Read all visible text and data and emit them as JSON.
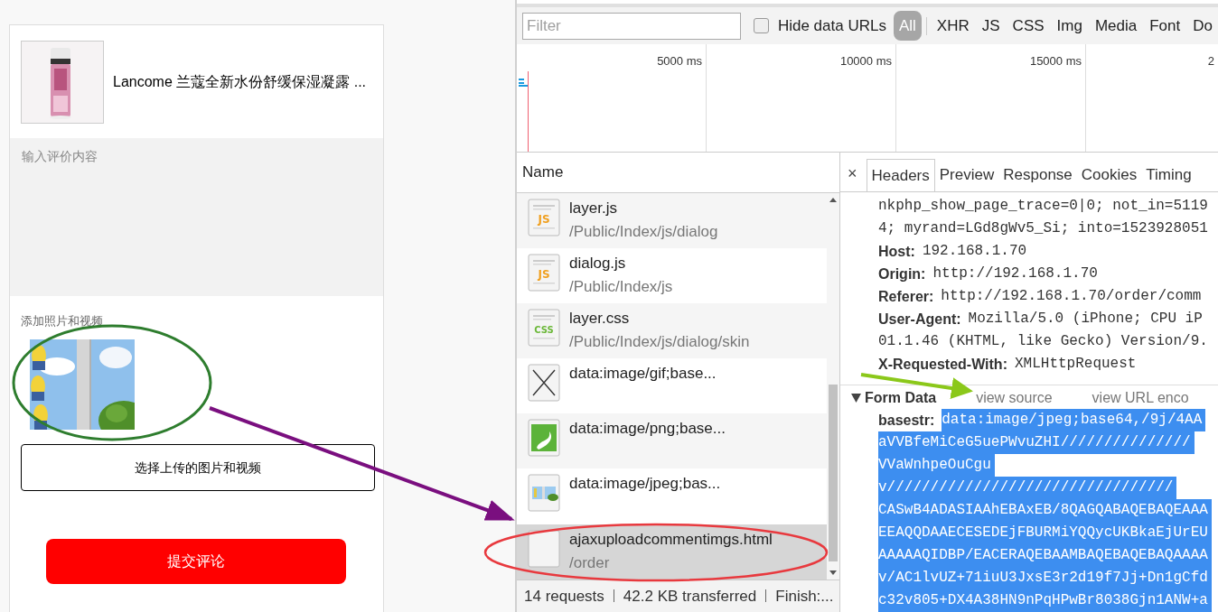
{
  "product": {
    "title": "Lancome 兰蔻全新水份舒缓保湿凝露 ..."
  },
  "review_field": {
    "placeholder": "输入评价内容"
  },
  "media": {
    "label": "添加照片和视频",
    "choose_button": "选择上传的图片和视频"
  },
  "submit_button": "提交评论",
  "devtools": {
    "filter": {
      "placeholder": "Filter"
    },
    "hide_data_urls": {
      "label": "Hide data URLs",
      "checked": false
    },
    "type_filters": [
      {
        "label": "All",
        "selected": true
      },
      {
        "label": "XHR",
        "selected": false
      },
      {
        "label": "JS",
        "selected": false
      },
      {
        "label": "CSS",
        "selected": false
      },
      {
        "label": "Img",
        "selected": false
      },
      {
        "label": "Media",
        "selected": false
      },
      {
        "label": "Font",
        "selected": false
      },
      {
        "label": "Do",
        "selected": false
      }
    ],
    "timeline_ticks": [
      "5000 ms",
      "10000 ms",
      "15000 ms",
      "2"
    ],
    "name_column": "Name",
    "requests": [
      {
        "kind": "js",
        "icon_label": "JS",
        "name": "layer.js",
        "path": "/Public/Index/js/dialog",
        "selected": false
      },
      {
        "kind": "js",
        "icon_label": "JS",
        "name": "dialog.js",
        "path": "/Public/Index/js",
        "selected": false
      },
      {
        "kind": "css",
        "icon_label": "CSS",
        "name": "layer.css",
        "path": "/Public/Index/js/dialog/skin",
        "selected": false
      },
      {
        "kind": "gif",
        "name": "data:image/gif;base...",
        "selected": false
      },
      {
        "kind": "png",
        "name": "data:image/png;base...",
        "selected": false
      },
      {
        "kind": "jpeg",
        "name": "data:image/jpeg;bas...",
        "selected": false
      },
      {
        "kind": "html",
        "name": "ajaxuploadcommentimgs.html",
        "path": "/order",
        "selected": true
      }
    ],
    "status": [
      "14 requests",
      "42.2 KB transferred",
      "Finish:..."
    ],
    "close": "×",
    "tabs": [
      {
        "label": "Headers",
        "selected": true
      },
      {
        "label": "Preview",
        "selected": false
      },
      {
        "label": "Response",
        "selected": false
      },
      {
        "label": "Cookies",
        "selected": false
      },
      {
        "label": "Timing",
        "selected": false
      }
    ],
    "header_lines": [
      {
        "value": "nkphp_show_page_trace=0|0; not_in=5119"
      },
      {
        "value": "4; myrand=LGd8gWv5_Si; into=1523928051"
      },
      {
        "key": "Host:",
        "value": "192.168.1.70"
      },
      {
        "key": "Origin:",
        "value": "http://192.168.1.70"
      },
      {
        "key": "Referer:",
        "value": "http://192.168.1.70/order/comm"
      },
      {
        "key": "User-Agent:",
        "value": "Mozilla/5.0 (iPhone; CPU iP"
      },
      {
        "value": "01.1.46 (KHTML, like Gecko) Version/9."
      },
      {
        "key": "X-Requested-With:",
        "value": "XMLHttpRequest"
      }
    ],
    "form_data": {
      "title": "Form Data",
      "expanded": true,
      "view_source": "view source",
      "view_url": "view URL enco",
      "lines": [
        {
          "key": "basestr:",
          "value": "data:image/jpeg;base64,/9j/4AA"
        },
        {
          "value": "aVVBfeMiCeG5uePWvuZHI///////////////"
        },
        {
          "value": "VVaWnhpeOuCgu"
        },
        {
          "value": "v/////////////////////////////////"
        },
        {
          "value": "CASwB4ADASIAAhEBAxEB/8QAGQABAQEBAQEAAA"
        },
        {
          "value": "EEAQQDAAECESEDEjFBURMiYQQycUKBkaEjUrEU"
        },
        {
          "value": "AAAAAQIDBP/EACERAQEBAAMBAQEBAQEBAQAAAA"
        },
        {
          "value": "v/AC1lvUZ+71iuU3JxsE3r2d19f7Jj+Dn1gCfd"
        },
        {
          "value": "c32v805+DX4A38HN9nPqHPwBr8038Gjn1ANW+a"
        }
      ]
    }
  }
}
